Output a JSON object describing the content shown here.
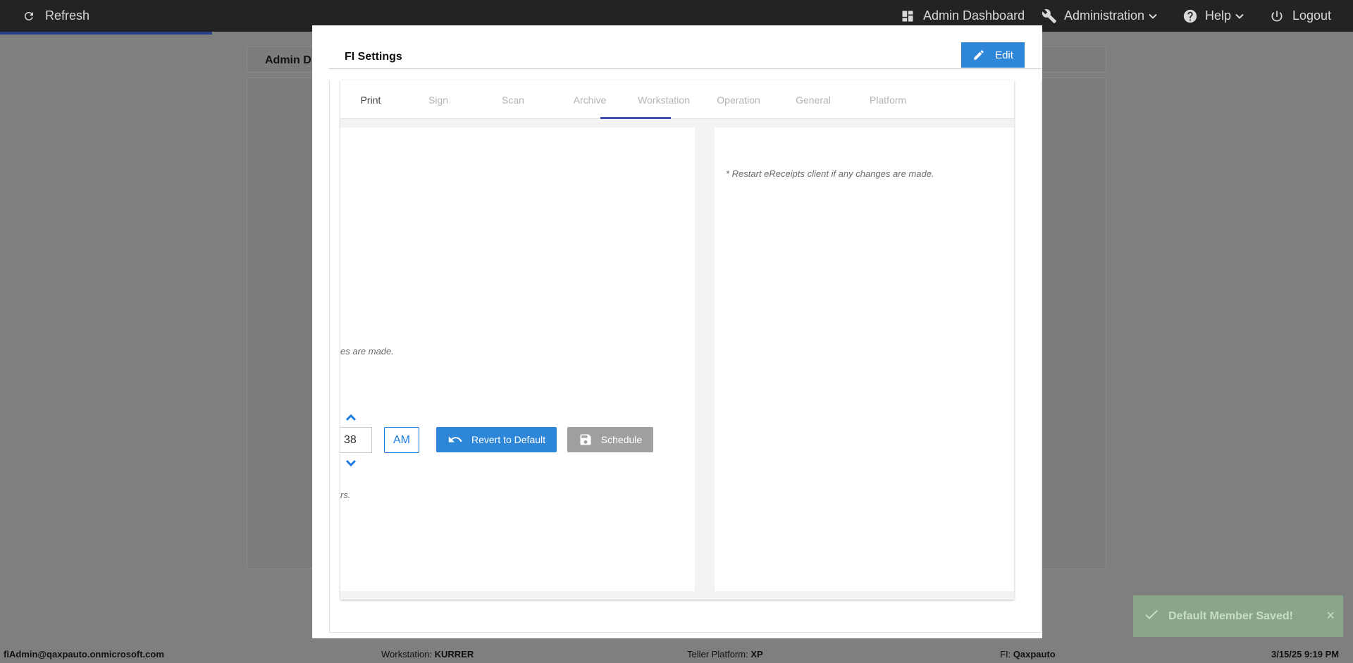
{
  "topbar": {
    "refresh_label": "Refresh",
    "admin_dashboard_label": "Admin Dashboard",
    "administration_label": "Administration",
    "help_label": "Help",
    "logout_label": "Logout"
  },
  "background": {
    "tab_label": "Admin D"
  },
  "modal": {
    "title": "FI Settings",
    "edit_label": "Edit",
    "tabs": [
      {
        "label": "Print"
      },
      {
        "label": "Sign"
      },
      {
        "label": "Scan"
      },
      {
        "label": "Archive"
      },
      {
        "label": "Workstation"
      },
      {
        "label": "Operation"
      },
      {
        "label": "General"
      },
      {
        "label": "Platform"
      }
    ],
    "active_tab": "Archive",
    "left_panel": {
      "note_partial": "es are made.",
      "minute_value": "38",
      "ampm_value": "AM",
      "revert_label": "Revert to Default",
      "schedule_label": "Schedule",
      "note_partial_2": "rs."
    },
    "right_panel": {
      "note": "* Restart eReceipts client if any changes are made."
    }
  },
  "toast": {
    "message": "Default Member Saved!",
    "close_symbol": "×"
  },
  "footer": {
    "user": "fiAdmin@qaxpauto.onmicrosoft.com",
    "workstation_label": "Workstation:",
    "workstation_value": "KURRER",
    "teller_platform_label": "Teller Platform:",
    "teller_platform_value": "XP",
    "fi_label": "FI:",
    "fi_value": "Qaxpauto",
    "datetime": "3/15/25 9:19 PM"
  },
  "colors": {
    "accent": "#2e86d9",
    "tab_indicator": "#3f51b5",
    "toast_bg": "#8aa68a"
  }
}
